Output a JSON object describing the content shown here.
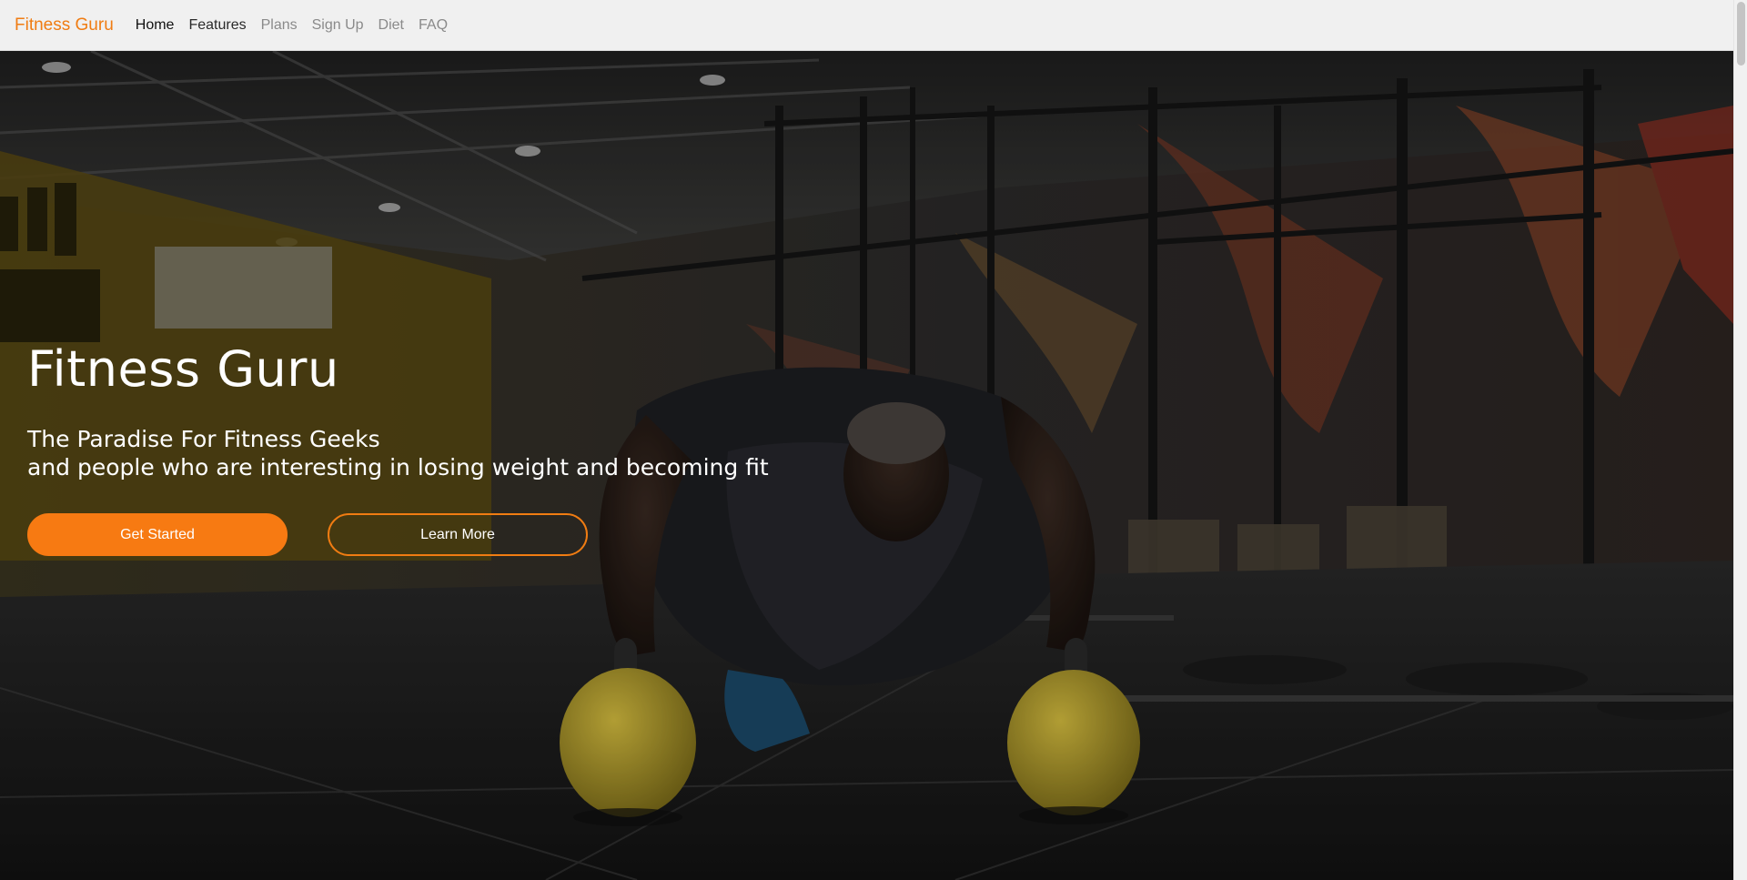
{
  "navbar": {
    "brand": "Fitness Guru",
    "links": [
      "Home",
      "Features",
      "Plans",
      "Sign Up",
      "Diet",
      "FAQ"
    ]
  },
  "hero": {
    "title": "Fitness Guru",
    "subtitle_line1": "The Paradise For Fitness Geeks",
    "subtitle_line2": "and people who are interesting in losing weight and becoming fit",
    "primary_button": "Get Started",
    "secondary_button": "Learn More"
  },
  "colors": {
    "brand": "#f07c12",
    "button_primary": "#f77a12",
    "navbar_bg": "#f0f0f0"
  }
}
